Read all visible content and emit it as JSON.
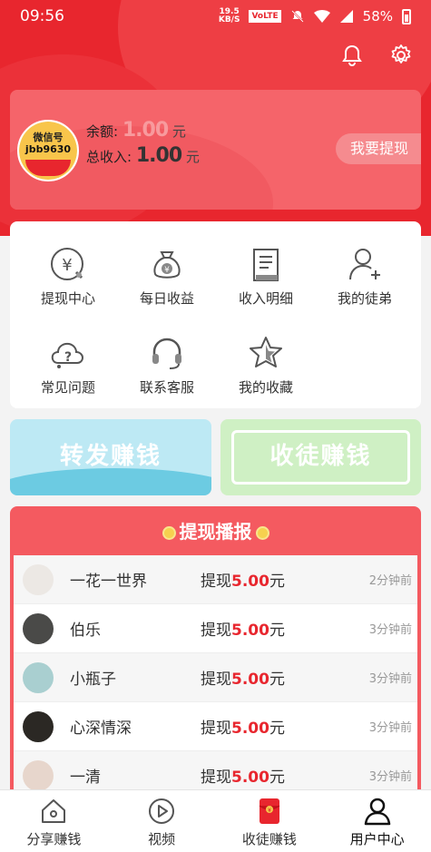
{
  "status": {
    "time": "09:56",
    "speed_top": "19.5",
    "speed_bottom": "KB/S",
    "volte": "VoLTE",
    "battery": "58%"
  },
  "header": {
    "bell_icon": "bell-icon",
    "settings_icon": "gear-icon"
  },
  "account": {
    "avatar_line1": "微信号",
    "avatar_line2": "jbb9630",
    "balance_label": "余额:",
    "balance_value": "1.00",
    "balance_unit": "元",
    "total_label": "总收入:",
    "total_value": "1.00",
    "total_unit": "元",
    "withdraw_button": "我要提现"
  },
  "menu": {
    "items": [
      {
        "label": "提现中心",
        "icon": "yuan-exchange-icon"
      },
      {
        "label": "每日收益",
        "icon": "money-bag-icon"
      },
      {
        "label": "收入明细",
        "icon": "ledger-icon"
      },
      {
        "label": "我的徒弟",
        "icon": "add-user-icon"
      },
      {
        "label": "常见问题",
        "icon": "question-cloud-icon"
      },
      {
        "label": "联系客服",
        "icon": "headset-icon"
      },
      {
        "label": "我的收藏",
        "icon": "star-icon"
      }
    ]
  },
  "promo": {
    "share_label": "转发赚钱",
    "recruit_label": "收徒赚钱"
  },
  "board": {
    "title": "提现播报",
    "rows": [
      {
        "name": "一花一世界",
        "prefix": "提现",
        "amount": "5.00",
        "unit": "元",
        "time": "2分钟前"
      },
      {
        "name": "伯乐",
        "prefix": "提现",
        "amount": "5.00",
        "unit": "元",
        "time": "3分钟前"
      },
      {
        "name": "小瓶子",
        "prefix": "提现",
        "amount": "5.00",
        "unit": "元",
        "time": "3分钟前"
      },
      {
        "name": "心深情深",
        "prefix": "提现",
        "amount": "5.00",
        "unit": "元",
        "time": "3分钟前"
      },
      {
        "name": "一清",
        "prefix": "提现",
        "amount": "5.00",
        "unit": "元",
        "time": "3分钟前"
      }
    ]
  },
  "tabbar": {
    "items": [
      {
        "label": "分享赚钱",
        "icon": "home-share-icon"
      },
      {
        "label": "视频",
        "icon": "play-icon"
      },
      {
        "label": "收徒赚钱",
        "icon": "red-envelope-icon"
      },
      {
        "label": "用户中心",
        "icon": "user-icon"
      }
    ]
  },
  "colors": {
    "primary": "#e8262e",
    "card": "#f5646a",
    "board": "#f45a60"
  }
}
